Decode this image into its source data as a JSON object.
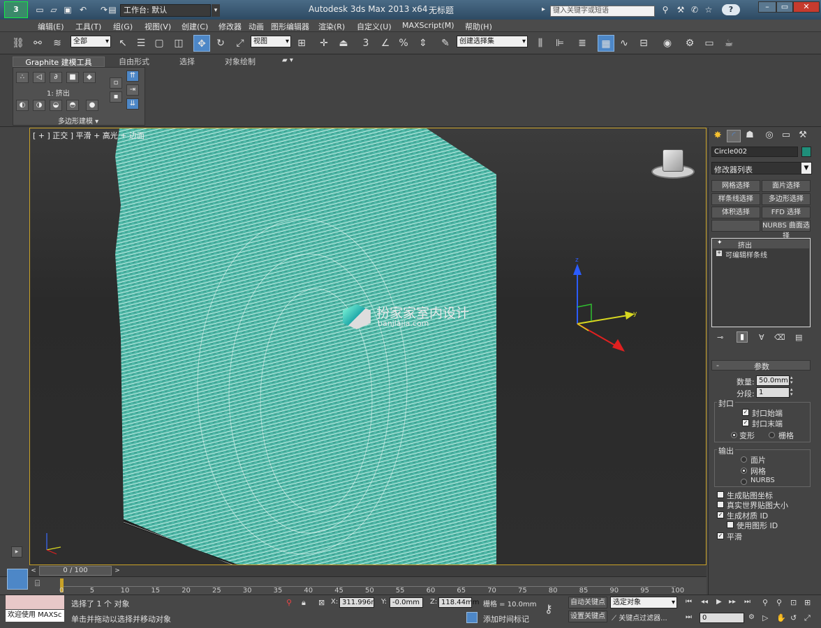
{
  "titlebar": {
    "workspace": "工作台: 默认",
    "app_title": "Autodesk 3ds Max  2013 x64",
    "doc_title": "无标题",
    "search_placeholder": "键入关键字或短语",
    "help": "?"
  },
  "menu": [
    "编辑(E)",
    "工具(T)",
    "组(G)",
    "视图(V)",
    "创建(C)",
    "修改器",
    "动画",
    "图形编辑器",
    "渲染(R)",
    "自定义(U)",
    "MAXScript(M)",
    "帮助(H)"
  ],
  "toolbar": {
    "filter": "全部",
    "ref_coord": "视图",
    "selection_set": "创建选择集",
    "snap_label": "3",
    "percent_label": "%"
  },
  "ribbon": {
    "tabs": [
      "Graphite 建模工具",
      "自由形式",
      "选择",
      "对象绘制"
    ],
    "active_tab": 0,
    "panel_status": "1: 挤出",
    "panel_title": "多边形建模"
  },
  "viewport": {
    "label": "[ + ] 正交 ] 平滑 + 高光 + 边面",
    "watermark_cn": "扮家家室内设计",
    "watermark_en": "banjiajia.com",
    "axis_x": "x",
    "axis_y": "y",
    "axis_z": "z",
    "mesh_color": "#5fc7b6"
  },
  "command_panel": {
    "object_name": "Circle002",
    "object_color": "#1f8f7a",
    "modifier_list": "修改器列表",
    "modifier_buttons": [
      "网格选择",
      "面片选择",
      "样条线选择",
      "多边形选择",
      "体积选择",
      "FFD 选择",
      "",
      "NURBS 曲面选择"
    ],
    "stack": [
      "挤出",
      "可编辑样条线"
    ],
    "params_title": "参数",
    "amount_label": "数量:",
    "amount_value": "50.0mm",
    "segments_label": "分段:",
    "segments_value": "1",
    "capping_title": "封口",
    "cap_start": "封口始端",
    "cap_end": "封口末端",
    "morph": "变形",
    "grid": "栅格",
    "output_title": "输出",
    "out_patch": "面片",
    "out_mesh": "网格",
    "out_nurbs": "NURBS",
    "gen_map": "生成贴图坐标",
    "real_world": "真实世界贴图大小",
    "gen_mat": "生成材质 ID",
    "use_shape": "使用图形 ID",
    "smooth": "平滑"
  },
  "timeline": {
    "frame": "0 / 100",
    "ticks": [
      "0",
      "5",
      "10",
      "15",
      "20",
      "25",
      "30",
      "35",
      "40",
      "45",
      "50",
      "55",
      "60",
      "65",
      "70",
      "75",
      "80",
      "85",
      "90",
      "95",
      "100"
    ]
  },
  "status": {
    "welcome": "欢迎使用 MAXSc",
    "selected": "选择了 1 个 对象",
    "prompt": "单击并拖动以选择并移动对象",
    "x_label": "X:",
    "x_value": "311.996mm",
    "y_label": "Y:",
    "y_value": "-0.0mm",
    "z_label": "Z:",
    "z_value": "118.44mm",
    "grid": "栅格 = 10.0mm",
    "auto_key": "自动关键点",
    "set_key": "设置关键点",
    "key_mode": "选定对象",
    "key_filter": "关键点过滤器...",
    "add_time_tag": "添加时间标记",
    "frame_field": "0"
  }
}
